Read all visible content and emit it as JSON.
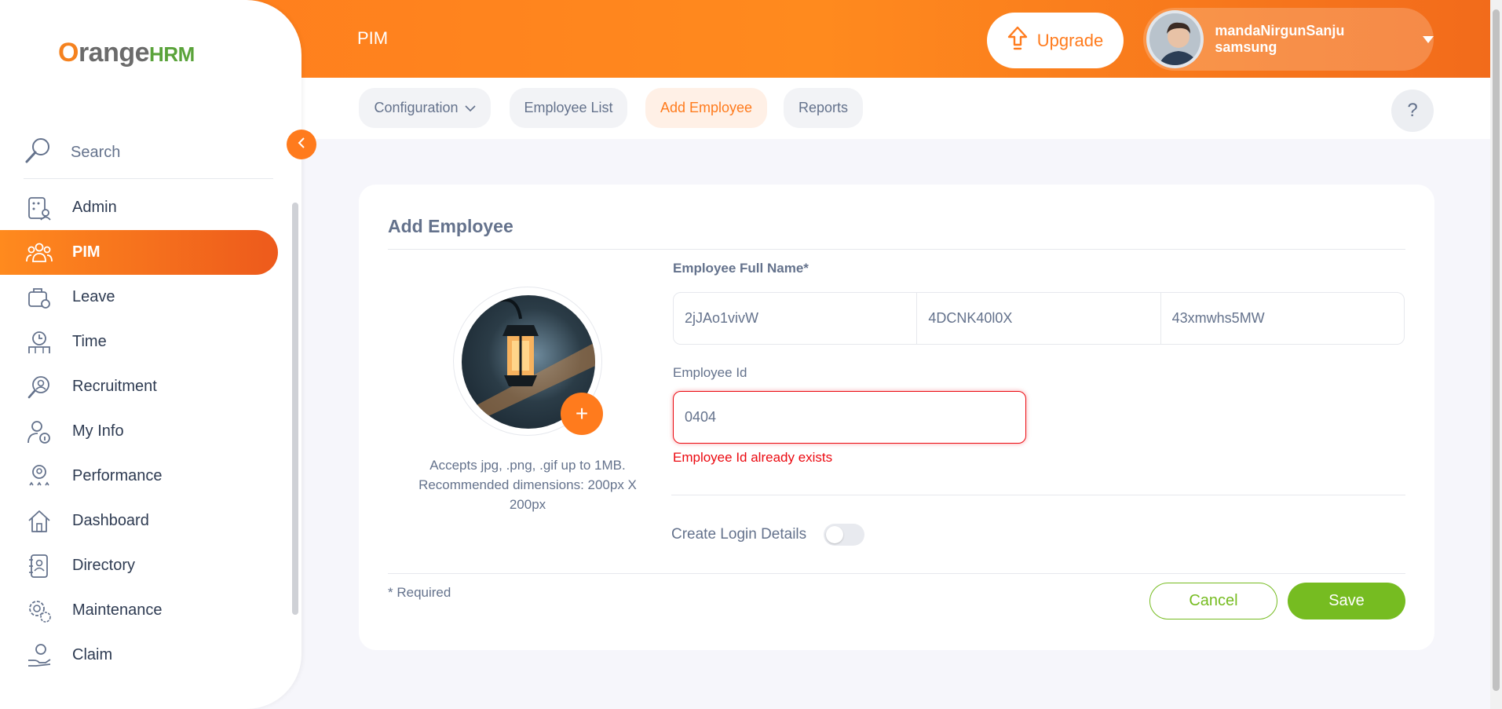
{
  "header": {
    "module_title": "PIM",
    "upgrade_label": "Upgrade",
    "user_name": "mandaNirgunSanju samsung"
  },
  "logo": {
    "o": "O",
    "range": "range",
    "hrm": "HRM"
  },
  "subnav": {
    "tabs": [
      {
        "label": "Configuration",
        "has_dropdown": true,
        "active": false
      },
      {
        "label": "Employee List",
        "active": false
      },
      {
        "label": "Add Employee",
        "active": true
      },
      {
        "label": "Reports",
        "active": false
      }
    ],
    "help_label": "?"
  },
  "sidebar": {
    "search_placeholder": "Search",
    "items": [
      {
        "label": "Admin",
        "icon": "admin-icon"
      },
      {
        "label": "PIM",
        "icon": "pim-icon",
        "active": true
      },
      {
        "label": "Leave",
        "icon": "leave-icon"
      },
      {
        "label": "Time",
        "icon": "time-icon"
      },
      {
        "label": "Recruitment",
        "icon": "recruitment-icon"
      },
      {
        "label": "My Info",
        "icon": "my-info-icon"
      },
      {
        "label": "Performance",
        "icon": "performance-icon"
      },
      {
        "label": "Dashboard",
        "icon": "dashboard-icon"
      },
      {
        "label": "Directory",
        "icon": "directory-icon"
      },
      {
        "label": "Maintenance",
        "icon": "maintenance-icon"
      },
      {
        "label": "Claim",
        "icon": "claim-icon"
      }
    ]
  },
  "form": {
    "title": "Add Employee",
    "photo_hint": "Accepts jpg, .png, .gif up to 1MB. Recommended dimensions: 200px X 200px",
    "photo_add_label": "+",
    "full_name_label": "Employee Full Name*",
    "first_name": "2jJAo1vivW",
    "middle_name": "4DCNK40l0X",
    "last_name": "43xmwhs5MW",
    "employee_id_label": "Employee Id",
    "employee_id": "0404",
    "employee_id_error": "Employee Id already exists",
    "create_login_label": "Create Login Details",
    "create_login_enabled": false,
    "required_note": "* Required",
    "cancel_label": "Cancel",
    "save_label": "Save"
  },
  "colors": {
    "brand_orange": "#ff7b1d",
    "save_green": "#76bc21",
    "error_red": "#eb0910"
  }
}
